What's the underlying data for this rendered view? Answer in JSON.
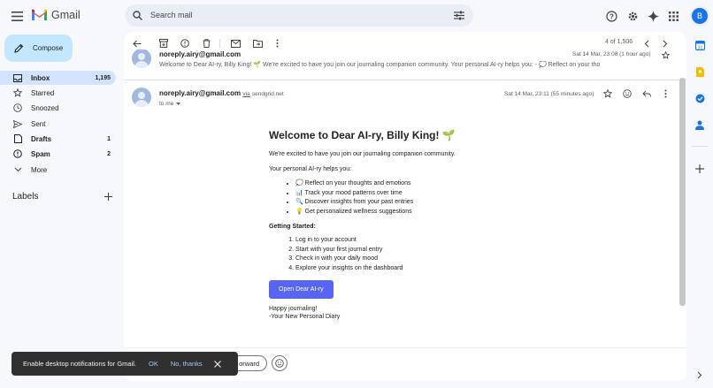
{
  "app": {
    "name": "Gmail"
  },
  "search": {
    "placeholder": "Search mail"
  },
  "sidebar": {
    "compose_label": "Compose",
    "items": [
      {
        "label": "Inbox",
        "count": "1,195"
      },
      {
        "label": "Starred",
        "count": ""
      },
      {
        "label": "Snoozed",
        "count": ""
      },
      {
        "label": "Sent",
        "count": ""
      },
      {
        "label": "Drafts",
        "count": "1"
      },
      {
        "label": "Spam",
        "count": "2"
      },
      {
        "label": "More",
        "count": ""
      }
    ],
    "labels_heading": "Labels"
  },
  "header": {
    "avatar_letter": "B"
  },
  "toolbar": {
    "pagination": "4 of 1,506"
  },
  "prev_message": {
    "sender": "noreply.airy@gmail.com",
    "date": "Sat 14 Mar, 23:08 (1 hour ago)",
    "snippet": "Welcome to Dear AI-ry, Billy King! 🌱 We're excited to have you join our journaling companion community. Your personal AI-ry helps you: - 💭 Reflect on your tho"
  },
  "message": {
    "sender": "noreply.airy@gmail.com",
    "via": "via",
    "via_domain": "sendgrid.net",
    "to": "to me",
    "date": "Sat 14 Mar, 23:11 (55 minutes ago)",
    "title": "Welcome to Dear AI-ry, Billy King! 🌱",
    "intro": "We're excited to have you join our journaling companion community.",
    "helps_label": "Your personal AI-ry helps you:",
    "features": [
      "💭 Reflect on your thoughts and emotions",
      "📊 Track your mood patterns over time",
      "🔍 Discover insights from your past entries",
      "💡 Get personalized wellness suggestions"
    ],
    "getting_started": "Getting Started:",
    "steps": [
      "Log in to your account",
      "Start with your first journal entry",
      "Check in with your daily mood",
      "Explore your insights on the dashboard"
    ],
    "cta": "Open Dear AI-ry",
    "signoff_1": "Happy journaling!",
    "signoff_2": "-Your New Personal Diary"
  },
  "actions": {
    "forward": "orward"
  },
  "snackbar": {
    "text": "Enable desktop notifications for Gmail.",
    "ok": "OK",
    "no": "No, thanks"
  }
}
